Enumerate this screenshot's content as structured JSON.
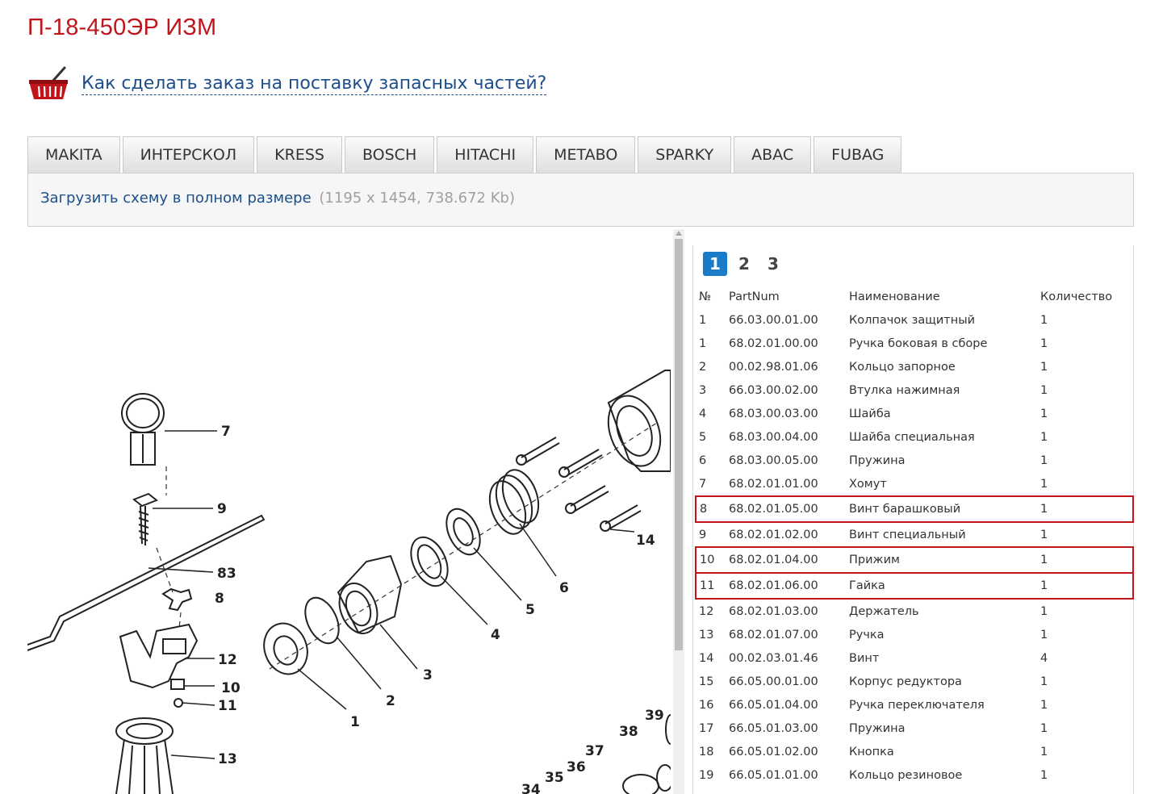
{
  "page": {
    "title": "П-18-450ЭР ИЗМ",
    "order_link": "Как сделать заказ на поставку запасных частей?"
  },
  "tabs": [
    "MAKITA",
    "ИНТЕРСКОЛ",
    "KRESS",
    "BOSCH",
    "HITACHI",
    "METABO",
    "SPARKY",
    "ABAC",
    "FUBAG"
  ],
  "download": {
    "link": "Загрузить схему в полном размере",
    "meta": "(1195 x 1454, 738.672 Kb)"
  },
  "diagram": {
    "labels": [
      "7",
      "9",
      "83",
      "8",
      "12",
      "10",
      "11",
      "13",
      "1",
      "2",
      "3",
      "4",
      "5",
      "6",
      "14",
      "39",
      "38",
      "37",
      "36",
      "35",
      "34"
    ]
  },
  "pagination": {
    "pages": [
      "1",
      "2",
      "3"
    ],
    "active": "1"
  },
  "parts": {
    "headers": [
      "№",
      "PartNum",
      "Наименование",
      "Количество"
    ],
    "rows": [
      {
        "no": "1",
        "part": "66.03.00.01.00",
        "name": "Колпачок защитный",
        "qty": "1",
        "highlight": false
      },
      {
        "no": "1",
        "part": "68.02.01.00.00",
        "name": "Ручка боковая в сборе",
        "qty": "1",
        "highlight": false
      },
      {
        "no": "2",
        "part": "00.02.98.01.06",
        "name": "Кольцо запорное",
        "qty": "1",
        "highlight": false
      },
      {
        "no": "3",
        "part": "66.03.00.02.00",
        "name": "Втулка нажимная",
        "qty": "1",
        "highlight": false
      },
      {
        "no": "4",
        "part": "68.03.00.03.00",
        "name": "Шайба",
        "qty": "1",
        "highlight": false
      },
      {
        "no": "5",
        "part": "68.03.00.04.00",
        "name": "Шайба специальная",
        "qty": "1",
        "highlight": false
      },
      {
        "no": "6",
        "part": "68.03.00.05.00",
        "name": "Пружина",
        "qty": "1",
        "highlight": false
      },
      {
        "no": "7",
        "part": "68.02.01.01.00",
        "name": "Хомут",
        "qty": "1",
        "highlight": false
      },
      {
        "no": "8",
        "part": "68.02.01.05.00",
        "name": "Винт барашковый",
        "qty": "1",
        "highlight": true
      },
      {
        "no": "9",
        "part": "68.02.01.02.00",
        "name": "Винт специальный",
        "qty": "1",
        "highlight": false
      },
      {
        "no": "10",
        "part": "68.02.01.04.00",
        "name": "Прижим",
        "qty": "1",
        "highlight": true
      },
      {
        "no": "11",
        "part": "68.02.01.06.00",
        "name": "Гайка",
        "qty": "1",
        "highlight": true
      },
      {
        "no": "12",
        "part": "68.02.01.03.00",
        "name": "Держатель",
        "qty": "1",
        "highlight": false
      },
      {
        "no": "13",
        "part": "68.02.01.07.00",
        "name": "Ручка",
        "qty": "1",
        "highlight": false
      },
      {
        "no": "14",
        "part": "00.02.03.01.46",
        "name": "Винт",
        "qty": "4",
        "highlight": false
      },
      {
        "no": "15",
        "part": "66.05.00.01.00",
        "name": "Корпус редуктора",
        "qty": "1",
        "highlight": false
      },
      {
        "no": "16",
        "part": "66.05.01.04.00",
        "name": "Ручка переключателя",
        "qty": "1",
        "highlight": false
      },
      {
        "no": "17",
        "part": "66.05.01.03.00",
        "name": "Пружина",
        "qty": "1",
        "highlight": false
      },
      {
        "no": "18",
        "part": "66.05.01.02.00",
        "name": "Кнопка",
        "qty": "1",
        "highlight": false
      },
      {
        "no": "19",
        "part": "66.05.01.01.00",
        "name": "Кольцо резиновое",
        "qty": "1",
        "highlight": false
      }
    ]
  },
  "colors": {
    "title": "#c0151b",
    "link": "#1c4e8a",
    "highlight_border": "#c0151b",
    "active_page": "#1a7bc9"
  },
  "icons": {
    "basket": "shopping-basket-icon"
  }
}
